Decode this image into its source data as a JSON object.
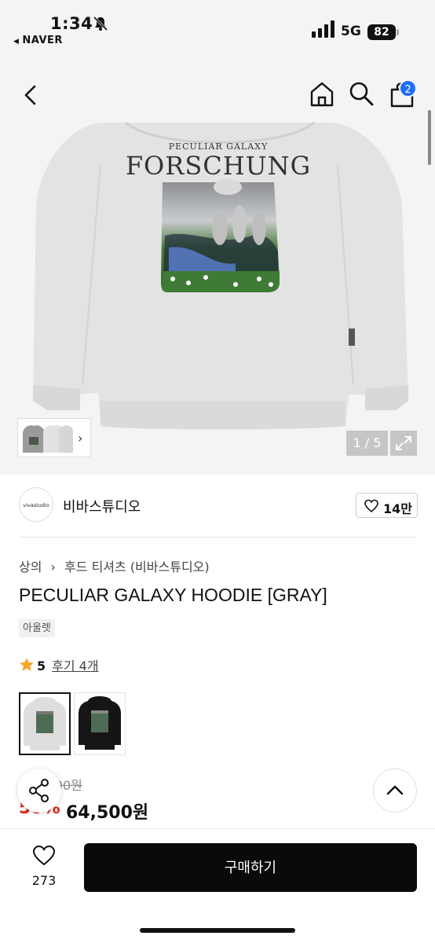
{
  "status_bar": {
    "time": "1:34",
    "back_app": "NAVER",
    "network": "5G",
    "battery": "82"
  },
  "nav": {
    "cart_badge": "2"
  },
  "gallery": {
    "print_top": "PECULIAR GALAXY",
    "print_main": "FORSCHUNG",
    "pager": "1 / 5",
    "hoodie_color": "#e3e3e3"
  },
  "store": {
    "logo_text": "vivastudio",
    "name": "비바스튜디오",
    "likes": "14만"
  },
  "product": {
    "breadcrumb": [
      "상의",
      "후드 티셔츠 (비바스튜디오)"
    ],
    "title": "PECULIAR GALAXY HOODIE [GRAY]",
    "tag": "아울렛",
    "rating": "5",
    "reviews": "후기 4개",
    "original_price": "129,000원",
    "discount": "50%",
    "price": "64,500원"
  },
  "bottom": {
    "wish_count": "273",
    "buy_label": "구매하기"
  },
  "colors": {
    "accent_blue": "#1e6ef5",
    "discount_red": "#e0241c",
    "buy_button": "#0a0a0a",
    "star": "#f5a623"
  }
}
